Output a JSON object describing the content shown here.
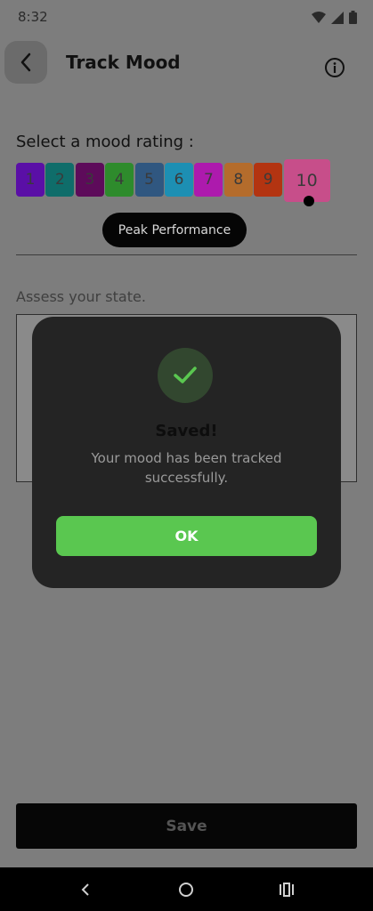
{
  "status_bar": {
    "time": "8:32"
  },
  "header": {
    "title": "Track Mood"
  },
  "mood": {
    "prompt": "Select a mood rating :",
    "ratings": [
      {
        "label": "1",
        "color": "#5a0fa6"
      },
      {
        "label": "2",
        "color": "#0f6d6a"
      },
      {
        "label": "3",
        "color": "#5d0b5a"
      },
      {
        "label": "4",
        "color": "#2e8b2c"
      },
      {
        "label": "5",
        "color": "#305780"
      },
      {
        "label": "6",
        "color": "#1d8fb3"
      },
      {
        "label": "7",
        "color": "#ad1aad"
      },
      {
        "label": "8",
        "color": "#b46c2c"
      },
      {
        "label": "9",
        "color": "#b33411"
      },
      {
        "label": "10",
        "color": "#c74e8a"
      }
    ],
    "selected": "10",
    "selected_label": "Peak Performance"
  },
  "assess": {
    "placeholder": "Assess your state."
  },
  "save_label": "Save",
  "dialog": {
    "title": "Saved!",
    "message": "Your mood has been tracked successfully.",
    "ok_label": "OK"
  }
}
